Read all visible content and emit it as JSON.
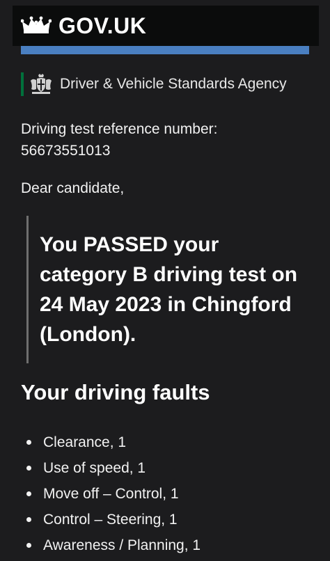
{
  "header": {
    "logo_icon": "crown-icon",
    "logo_text": "GOV.UK",
    "accent_color": "#4a7fc1"
  },
  "agency": {
    "icon": "royal-crest-icon",
    "name": "Driver & Vehicle Standards Agency"
  },
  "email": {
    "reference_label": "Driving test reference number:",
    "reference_number": "56673551013",
    "greeting": "Dear candidate,",
    "result_lines": [
      "You PASSED your",
      "category B driving test on",
      "24 May 2023 in Chingford",
      "(London)."
    ],
    "faults_heading": "Your driving faults",
    "faults": [
      "Clearance, 1",
      "Use of speed, 1",
      "Move off – Control, 1",
      "Control – Steering, 1",
      "Awareness / Planning, 1"
    ]
  }
}
